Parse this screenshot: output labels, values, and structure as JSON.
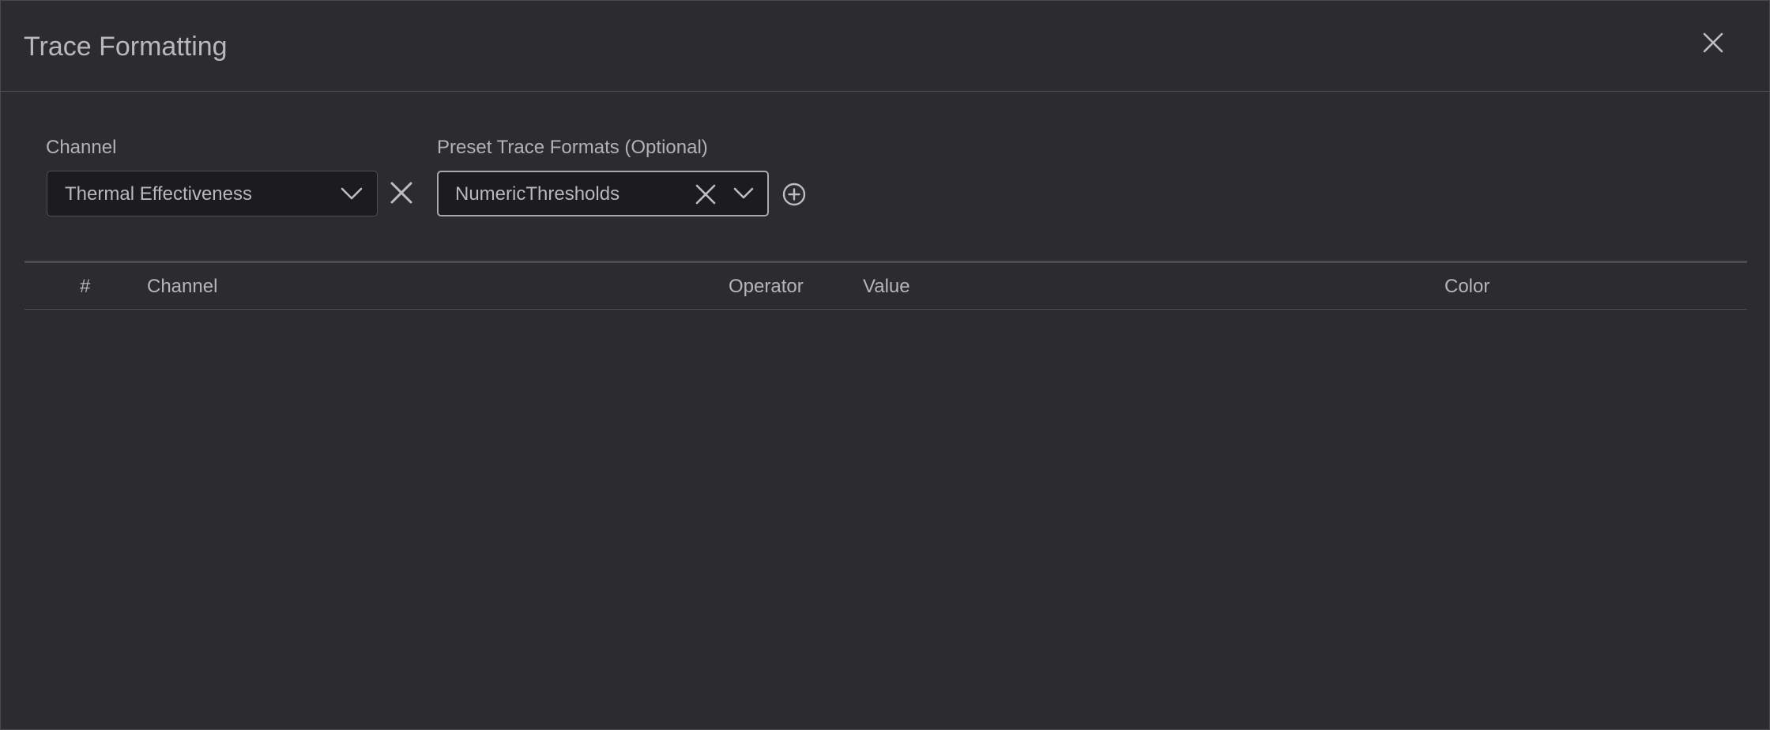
{
  "dialog": {
    "title": "Trace Formatting"
  },
  "channel_field": {
    "label": "Channel",
    "selected_value": "Thermal Effectiveness"
  },
  "preset_field": {
    "label": "Preset Trace Formats (Optional)",
    "selected_value": "NumericThresholds"
  },
  "table": {
    "columns": [
      "#",
      "Channel",
      "Operator",
      "Value",
      "Color"
    ],
    "rows": []
  },
  "icons": {
    "dialog_close": "close-icon",
    "channel_dropdown": "chevron-down-icon",
    "channel_clear": "clear-icon",
    "preset_clear": "clear-icon",
    "preset_dropdown": "chevron-down-icon",
    "preset_add": "add-circle-icon"
  },
  "colors": {
    "background": "#2c2c2e",
    "input_background": "#1c1c1e",
    "text": "#b9b9bb"
  }
}
